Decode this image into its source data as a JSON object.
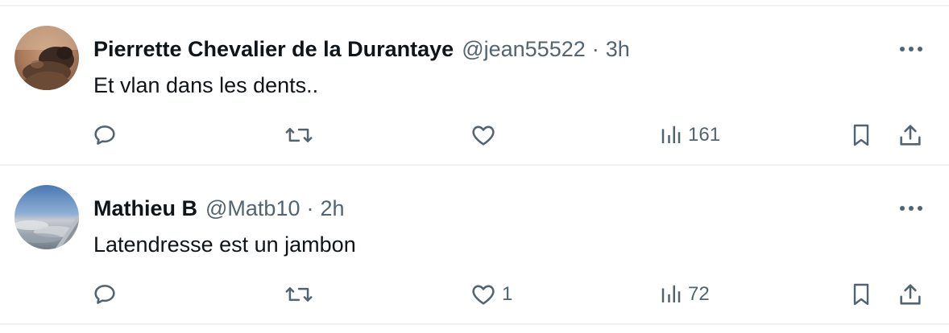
{
  "tweets": [
    {
      "name": "Pierrette Chevalier de la Durantaye",
      "handle": "@jean55522",
      "separator": "·",
      "time": "3h",
      "text": "Et vlan dans les dents..",
      "replies": "",
      "retweets": "",
      "likes": "",
      "views": "161",
      "avatar_icon": "cat-photo-avatar"
    },
    {
      "name": "Mathieu B",
      "handle": "@Matb10",
      "separator": "·",
      "time": "2h",
      "text": "Latendresse est un jambon",
      "replies": "",
      "retweets": "",
      "likes": "1",
      "views": "72",
      "avatar_icon": "sky-wing-photo-avatar"
    }
  ],
  "icons": {
    "reply": "reply-icon",
    "retweet": "retweet-icon",
    "like": "heart-icon",
    "views": "views-chart-icon",
    "bookmark": "bookmark-icon",
    "share": "share-icon",
    "more": "more-dots-icon"
  },
  "colors": {
    "text_primary": "#0f1419",
    "text_secondary": "#536471",
    "divider": "#eff3f4"
  }
}
